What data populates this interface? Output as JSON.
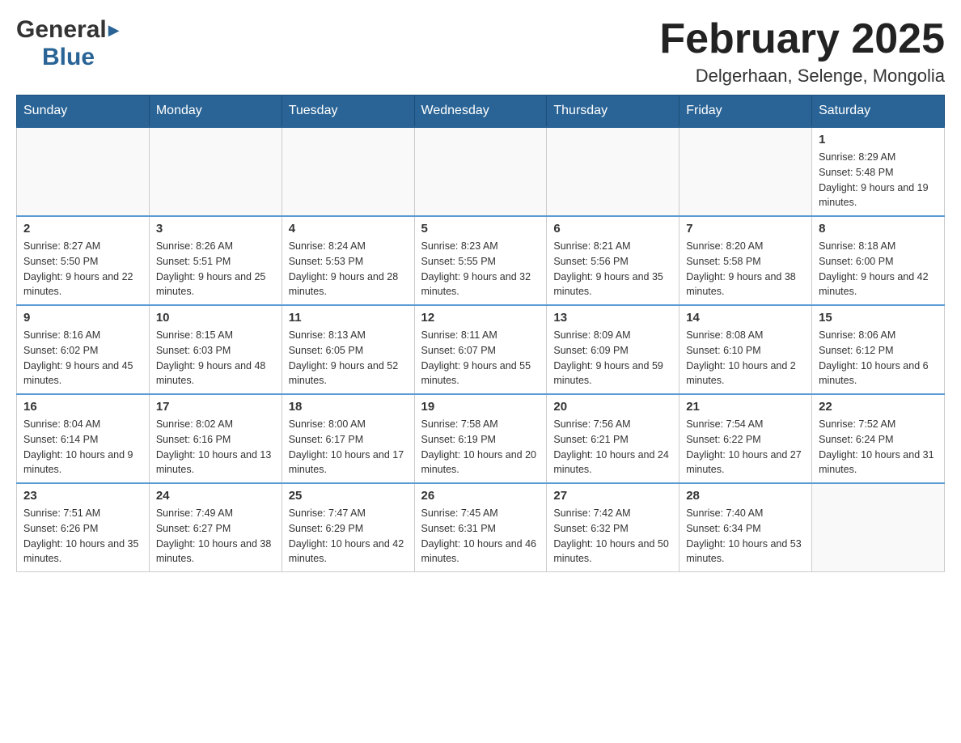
{
  "logo": {
    "general": "General",
    "blue": "Blue"
  },
  "header": {
    "title": "February 2025",
    "location": "Delgerhaan, Selenge, Mongolia"
  },
  "weekdays": [
    "Sunday",
    "Monday",
    "Tuesday",
    "Wednesday",
    "Thursday",
    "Friday",
    "Saturday"
  ],
  "weeks": [
    [
      {
        "day": "",
        "info": ""
      },
      {
        "day": "",
        "info": ""
      },
      {
        "day": "",
        "info": ""
      },
      {
        "day": "",
        "info": ""
      },
      {
        "day": "",
        "info": ""
      },
      {
        "day": "",
        "info": ""
      },
      {
        "day": "1",
        "info": "Sunrise: 8:29 AM\nSunset: 5:48 PM\nDaylight: 9 hours and 19 minutes."
      }
    ],
    [
      {
        "day": "2",
        "info": "Sunrise: 8:27 AM\nSunset: 5:50 PM\nDaylight: 9 hours and 22 minutes."
      },
      {
        "day": "3",
        "info": "Sunrise: 8:26 AM\nSunset: 5:51 PM\nDaylight: 9 hours and 25 minutes."
      },
      {
        "day": "4",
        "info": "Sunrise: 8:24 AM\nSunset: 5:53 PM\nDaylight: 9 hours and 28 minutes."
      },
      {
        "day": "5",
        "info": "Sunrise: 8:23 AM\nSunset: 5:55 PM\nDaylight: 9 hours and 32 minutes."
      },
      {
        "day": "6",
        "info": "Sunrise: 8:21 AM\nSunset: 5:56 PM\nDaylight: 9 hours and 35 minutes."
      },
      {
        "day": "7",
        "info": "Sunrise: 8:20 AM\nSunset: 5:58 PM\nDaylight: 9 hours and 38 minutes."
      },
      {
        "day": "8",
        "info": "Sunrise: 8:18 AM\nSunset: 6:00 PM\nDaylight: 9 hours and 42 minutes."
      }
    ],
    [
      {
        "day": "9",
        "info": "Sunrise: 8:16 AM\nSunset: 6:02 PM\nDaylight: 9 hours and 45 minutes."
      },
      {
        "day": "10",
        "info": "Sunrise: 8:15 AM\nSunset: 6:03 PM\nDaylight: 9 hours and 48 minutes."
      },
      {
        "day": "11",
        "info": "Sunrise: 8:13 AM\nSunset: 6:05 PM\nDaylight: 9 hours and 52 minutes."
      },
      {
        "day": "12",
        "info": "Sunrise: 8:11 AM\nSunset: 6:07 PM\nDaylight: 9 hours and 55 minutes."
      },
      {
        "day": "13",
        "info": "Sunrise: 8:09 AM\nSunset: 6:09 PM\nDaylight: 9 hours and 59 minutes."
      },
      {
        "day": "14",
        "info": "Sunrise: 8:08 AM\nSunset: 6:10 PM\nDaylight: 10 hours and 2 minutes."
      },
      {
        "day": "15",
        "info": "Sunrise: 8:06 AM\nSunset: 6:12 PM\nDaylight: 10 hours and 6 minutes."
      }
    ],
    [
      {
        "day": "16",
        "info": "Sunrise: 8:04 AM\nSunset: 6:14 PM\nDaylight: 10 hours and 9 minutes."
      },
      {
        "day": "17",
        "info": "Sunrise: 8:02 AM\nSunset: 6:16 PM\nDaylight: 10 hours and 13 minutes."
      },
      {
        "day": "18",
        "info": "Sunrise: 8:00 AM\nSunset: 6:17 PM\nDaylight: 10 hours and 17 minutes."
      },
      {
        "day": "19",
        "info": "Sunrise: 7:58 AM\nSunset: 6:19 PM\nDaylight: 10 hours and 20 minutes."
      },
      {
        "day": "20",
        "info": "Sunrise: 7:56 AM\nSunset: 6:21 PM\nDaylight: 10 hours and 24 minutes."
      },
      {
        "day": "21",
        "info": "Sunrise: 7:54 AM\nSunset: 6:22 PM\nDaylight: 10 hours and 27 minutes."
      },
      {
        "day": "22",
        "info": "Sunrise: 7:52 AM\nSunset: 6:24 PM\nDaylight: 10 hours and 31 minutes."
      }
    ],
    [
      {
        "day": "23",
        "info": "Sunrise: 7:51 AM\nSunset: 6:26 PM\nDaylight: 10 hours and 35 minutes."
      },
      {
        "day": "24",
        "info": "Sunrise: 7:49 AM\nSunset: 6:27 PM\nDaylight: 10 hours and 38 minutes."
      },
      {
        "day": "25",
        "info": "Sunrise: 7:47 AM\nSunset: 6:29 PM\nDaylight: 10 hours and 42 minutes."
      },
      {
        "day": "26",
        "info": "Sunrise: 7:45 AM\nSunset: 6:31 PM\nDaylight: 10 hours and 46 minutes."
      },
      {
        "day": "27",
        "info": "Sunrise: 7:42 AM\nSunset: 6:32 PM\nDaylight: 10 hours and 50 minutes."
      },
      {
        "day": "28",
        "info": "Sunrise: 7:40 AM\nSunset: 6:34 PM\nDaylight: 10 hours and 53 minutes."
      },
      {
        "day": "",
        "info": ""
      }
    ]
  ]
}
